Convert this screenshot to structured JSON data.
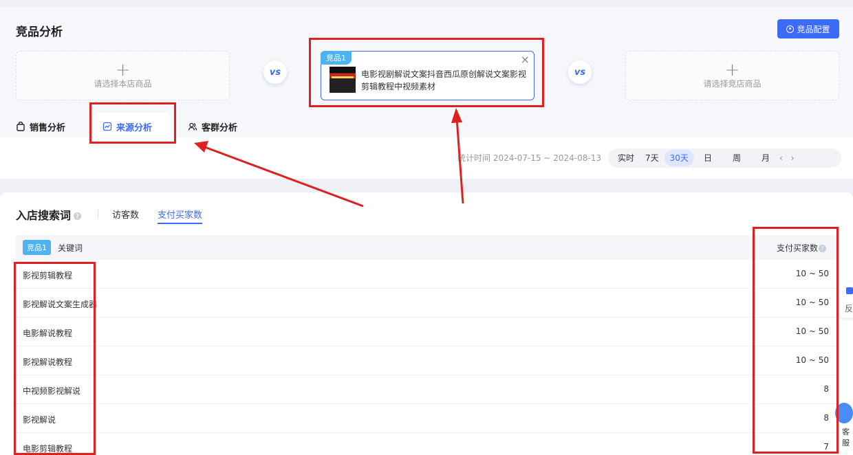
{
  "header": {
    "title": "竞品分析",
    "config_button": "竞品配置"
  },
  "compare": {
    "left_slot": "请选择本店商品",
    "right_slot": "请选择竞店商品",
    "vs": "vs",
    "product": {
      "tag": "竞品1",
      "title": "电影视剧解说文案抖音西瓜原创解说文案影视剪辑教程中视频素材",
      "close": "×"
    }
  },
  "tabs": [
    {
      "label": "销售分析",
      "icon": "shopping-bag-icon"
    },
    {
      "label": "来源分析",
      "icon": "trend-chart-icon",
      "active": true
    },
    {
      "label": "客群分析",
      "icon": "users-icon"
    }
  ],
  "filter": {
    "stat_time": "统计时间 2024-07-15 ~ 2024-08-13",
    "ranges": [
      "实时",
      "7天",
      "30天",
      "日",
      "周",
      "月"
    ],
    "selected": "30天"
  },
  "section": {
    "title": "入店搜索词",
    "subtabs": [
      "访客数",
      "支付买家数"
    ],
    "active_subtab": "支付买家数"
  },
  "table": {
    "tag": "竞品1",
    "col_keyword": "关键词",
    "col_buyers": "支付买家数",
    "rows": [
      {
        "keyword": "影视剪辑教程",
        "value": "10 ~ 50"
      },
      {
        "keyword": "影视解说文案生成器",
        "value": "10 ~ 50"
      },
      {
        "keyword": "电影解说教程",
        "value": "10 ~ 50"
      },
      {
        "keyword": "影视解说教程",
        "value": "10 ~ 50"
      },
      {
        "keyword": "中视频影视解说",
        "value": "8"
      },
      {
        "keyword": "影视解说",
        "value": "8"
      },
      {
        "keyword": "电影剪辑教程",
        "value": "7"
      }
    ]
  },
  "side": {
    "feedback": "反",
    "service": "客服"
  },
  "colors": {
    "accent": "#3d6bf5",
    "tag": "#4fb3f2",
    "annotation": "#e02020"
  }
}
